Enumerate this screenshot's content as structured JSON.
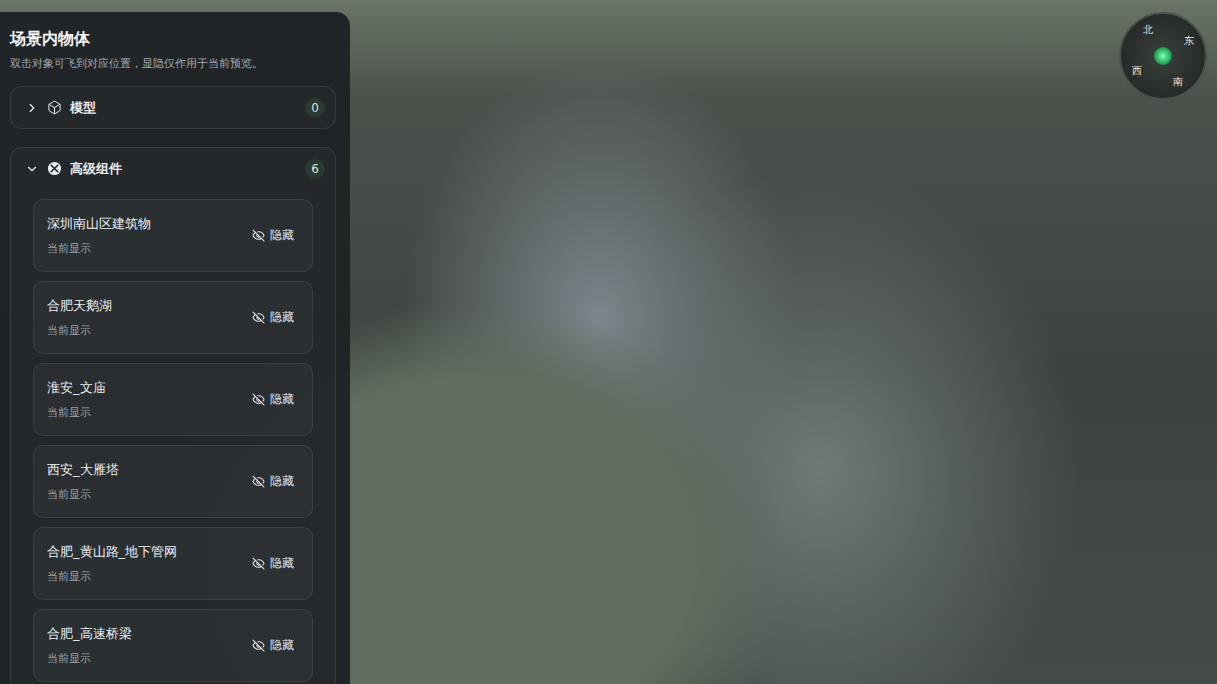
{
  "panel": {
    "title": "场景内物体",
    "subtitle": "双击对象可飞到对应位置，显隐仅作用于当前预览。"
  },
  "groups": [
    {
      "label": "模型",
      "count": "0",
      "expanded": false,
      "kind": "model",
      "items": []
    },
    {
      "label": "高级组件",
      "count": "6",
      "expanded": true,
      "kind": "component",
      "items": [
        {
          "name": "深圳南山区建筑物",
          "status": "当前显示",
          "action": "隐藏"
        },
        {
          "name": "合肥天鹅湖",
          "status": "当前显示",
          "action": "隐藏"
        },
        {
          "name": "淮安_文庙",
          "status": "当前显示",
          "action": "隐藏"
        },
        {
          "name": "西安_大雁塔",
          "status": "当前显示",
          "action": "隐藏"
        },
        {
          "name": "合肥_黄山路_地下管网",
          "status": "当前显示",
          "action": "隐藏"
        },
        {
          "name": "合肥_高速桥梁",
          "status": "当前显示",
          "action": "隐藏"
        }
      ]
    }
  ],
  "compass": {
    "labels": [
      "北",
      "东",
      "南",
      "西"
    ]
  }
}
